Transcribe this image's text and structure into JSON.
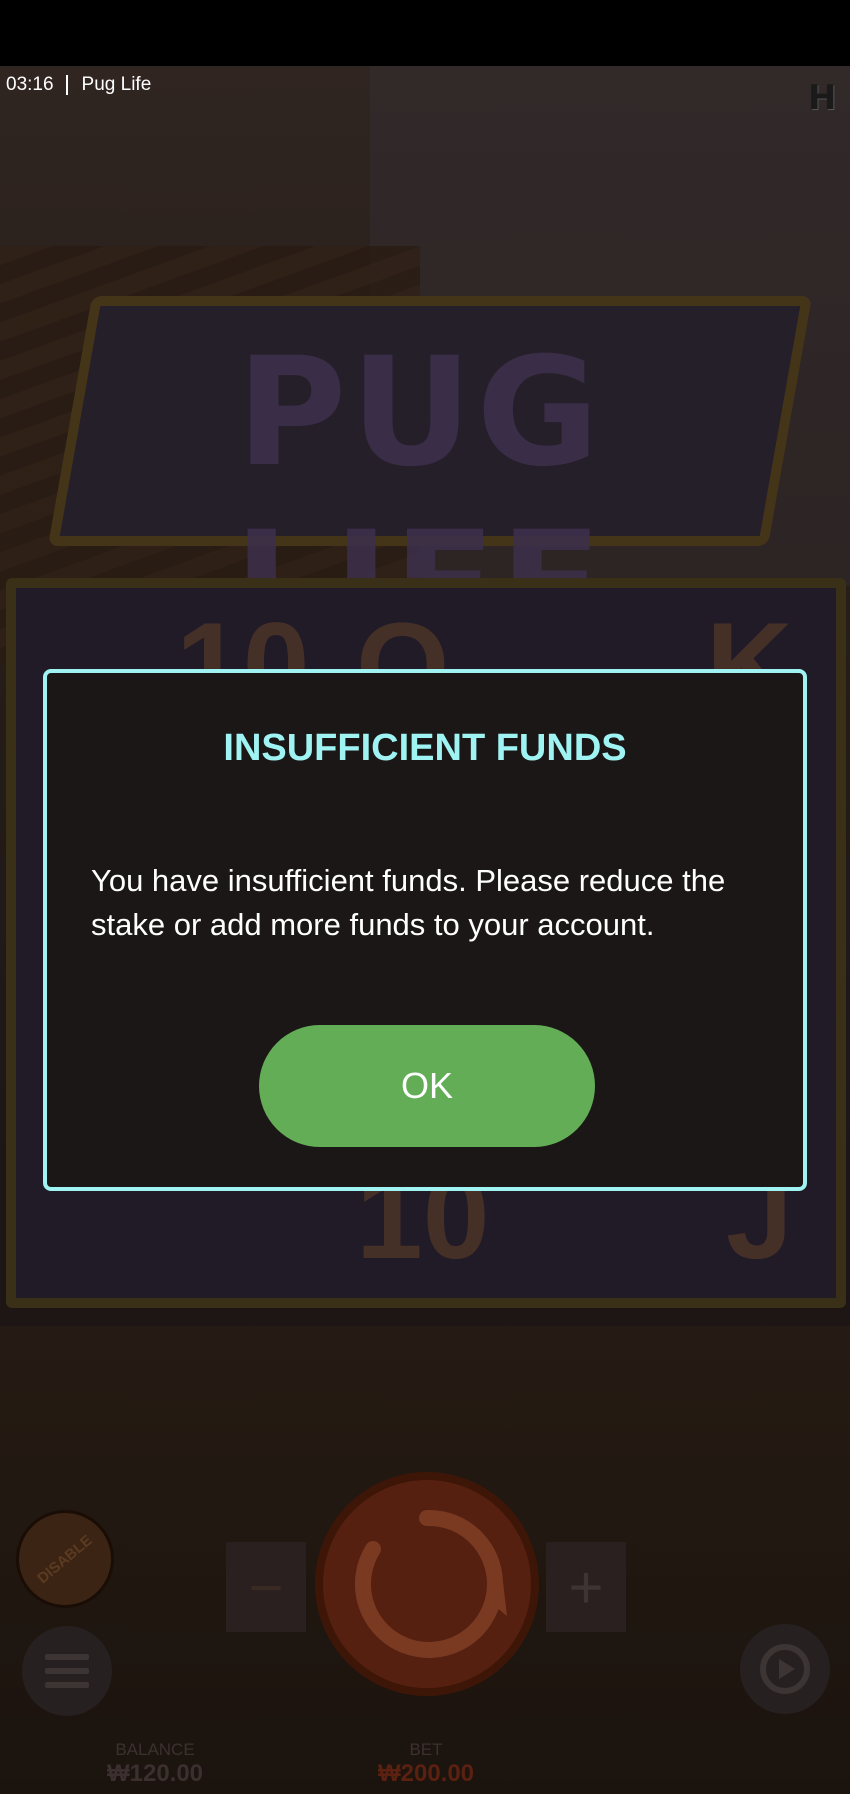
{
  "status": {
    "time": "03:16",
    "app_title": "Pug Life"
  },
  "game": {
    "logo_text": "PUG LIFE"
  },
  "modal": {
    "title": "INSUFFICIENT FUNDS",
    "message": "You have insufficient funds. Please reduce the stake or add more funds to your account.",
    "ok_label": "OK"
  },
  "controls": {
    "disable_label": "DISABLE",
    "minus_label": "−",
    "plus_label": "+"
  },
  "footer": {
    "balance_label": "BALANCE",
    "balance_value": "₩120.00",
    "bet_label": "BET",
    "bet_value": "₩200.00"
  },
  "colors": {
    "accent": "#9ff3f3",
    "ok_button": "#63ad57",
    "modal_bg": "#1b1716"
  }
}
